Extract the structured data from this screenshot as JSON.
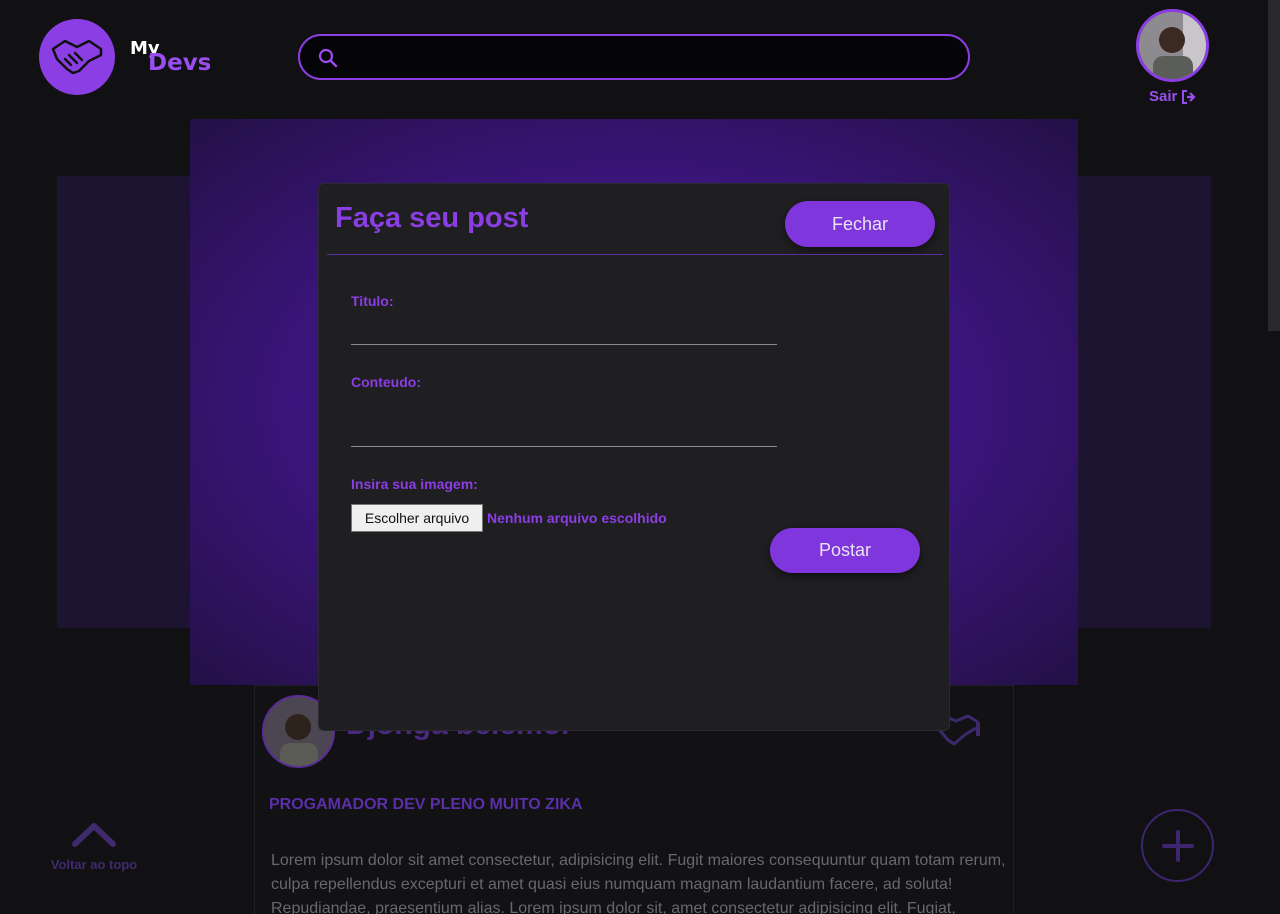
{
  "brand": {
    "my": "My",
    "devs": "Devs"
  },
  "header": {
    "search_placeholder": "",
    "logout_label": "Sair"
  },
  "feed": {
    "author": "Djonga belemor",
    "role": "PROGAMADOR DEV PLENO MUITO ZIKA",
    "text": "Lorem ipsum dolor sit amet consectetur, adipisicing elit. Fugit maiores consequuntur quam totam rerum, culpa repellendus excepturi et amet quasi eius numquam magnam laudantium facere, ad soluta! Repudiandae, praesentium alias. Lorem ipsum dolor sit, amet consectetur adipisicing elit. Fugiat,"
  },
  "back_to_top": "Voltar ao topo",
  "modal": {
    "title": "Faça seu post",
    "close_label": "Fechar",
    "title_label": "Titulo:",
    "content_label": "Conteudo:",
    "image_label": "Insira sua imagem:",
    "file_button": "Escolher arquivo",
    "file_status": "Nenhum arquivo escolhido",
    "post_label": "Postar"
  },
  "colors": {
    "accent": "#8a3ee3",
    "background": "#111013",
    "modal": "#1f1e21"
  },
  "icons": {
    "logo": "handshake-icon",
    "search": "search-icon",
    "logout": "sign-out-icon",
    "back_top": "chevron-up-icon",
    "fab": "plus-icon"
  }
}
